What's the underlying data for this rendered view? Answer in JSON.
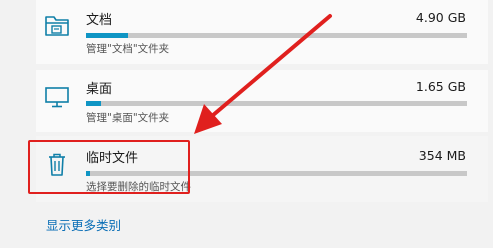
{
  "storage_items": [
    {
      "name": "文档",
      "size": "4.90 GB",
      "description": "管理\"文档\"文件夹",
      "usage_fraction": 0.11,
      "icon": "documents-folder-icon"
    },
    {
      "name": "桌面",
      "size": "1.65 GB",
      "description": "管理\"桌面\"文件夹",
      "usage_fraction": 0.04,
      "icon": "desktop-monitor-icon"
    },
    {
      "name": "临时文件",
      "size": "354 MB",
      "description": "选择要删除的临时文件",
      "usage_fraction": 0.01,
      "icon": "trash-bin-icon"
    }
  ],
  "show_more_label": "显示更多类别",
  "colors": {
    "accent": "#0f95c4",
    "link": "#0a6eb6",
    "annotation": "#e0201e",
    "icon": "#0f7fa8"
  }
}
